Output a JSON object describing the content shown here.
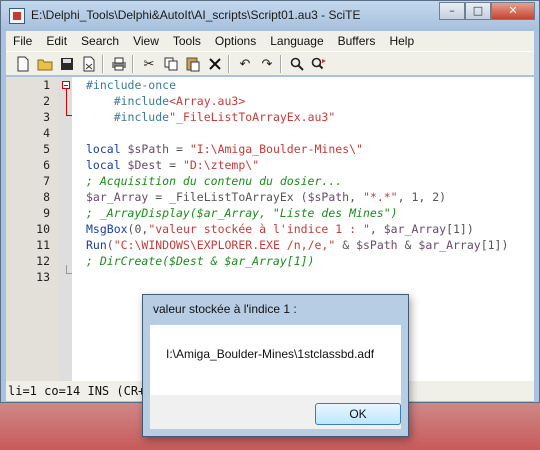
{
  "window": {
    "title": "E:\\Delphi_Tools\\Delphi&AutoIt\\AI_scripts\\Script01.au3 - SciTE",
    "buttons": {
      "minimize": "–",
      "maximize": "□",
      "close": "✕"
    }
  },
  "menu": [
    "File",
    "Edit",
    "Search",
    "View",
    "Tools",
    "Options",
    "Language",
    "Buffers",
    "Help"
  ],
  "toolbar_icons": [
    "new-file-icon",
    "open-folder-icon",
    "save-icon",
    "close-file-icon",
    "print-icon",
    "cut-icon",
    "copy-icon",
    "paste-icon",
    "delete-icon",
    "undo-icon",
    "redo-icon",
    "find-icon",
    "replace-icon"
  ],
  "editor": {
    "lines": [
      {
        "n": "1",
        "parts": [
          {
            "t": "#include-once",
            "c": "dir"
          }
        ]
      },
      {
        "n": "2",
        "parts": [
          {
            "t": "    #include",
            "c": "dir"
          },
          {
            "t": "<Array.au3>",
            "c": "str"
          }
        ]
      },
      {
        "n": "3",
        "parts": [
          {
            "t": "    #include",
            "c": "dir"
          },
          {
            "t": "\"_FileListToArrayEx.au3\"",
            "c": "str"
          }
        ]
      },
      {
        "n": "4",
        "parts": []
      },
      {
        "n": "5",
        "parts": [
          {
            "t": "local ",
            "c": "kw"
          },
          {
            "t": "$sPath",
            "c": "var"
          },
          {
            "t": " = ",
            "c": "op"
          },
          {
            "t": "\"I:\\Amiga_Boulder-Mines\\\"",
            "c": "str"
          }
        ]
      },
      {
        "n": "6",
        "parts": [
          {
            "t": "local ",
            "c": "kw"
          },
          {
            "t": "$Dest",
            "c": "var"
          },
          {
            "t": " = ",
            "c": "op"
          },
          {
            "t": "\"D:\\ztemp\\\"",
            "c": "str"
          }
        ]
      },
      {
        "n": "7",
        "parts": [
          {
            "t": "; Acquisition du contenu du dosier...",
            "c": "com"
          }
        ]
      },
      {
        "n": "8",
        "parts": [
          {
            "t": "$ar_Array",
            "c": "var"
          },
          {
            "t": " = _FileListToArrayEx (",
            "c": "op"
          },
          {
            "t": "$sPath",
            "c": "var"
          },
          {
            "t": ", ",
            "c": "op"
          },
          {
            "t": "\"*.*\"",
            "c": "str"
          },
          {
            "t": ", 1, 2)",
            "c": "op"
          }
        ]
      },
      {
        "n": "9",
        "parts": [
          {
            "t": "; _ArrayDisplay($ar_Array, \"Liste des Mines\")",
            "c": "com"
          }
        ]
      },
      {
        "n": "10",
        "parts": [
          {
            "t": "MsgBox",
            "c": "fn"
          },
          {
            "t": "(0,",
            "c": "op"
          },
          {
            "t": "\"valeur stockée à l'indice 1 : \"",
            "c": "str"
          },
          {
            "t": ", ",
            "c": "op"
          },
          {
            "t": "$ar_Array",
            "c": "var"
          },
          {
            "t": "[1])",
            "c": "op"
          }
        ]
      },
      {
        "n": "11",
        "parts": [
          {
            "t": "Run",
            "c": "fn"
          },
          {
            "t": "(",
            "c": "op"
          },
          {
            "t": "\"C:\\WINDOWS\\EXPLORER.EXE /n,/e,\"",
            "c": "str"
          },
          {
            "t": " & ",
            "c": "op"
          },
          {
            "t": "$sPath",
            "c": "var"
          },
          {
            "t": " & ",
            "c": "op"
          },
          {
            "t": "$ar_Array",
            "c": "var"
          },
          {
            "t": "[1])",
            "c": "op"
          }
        ]
      },
      {
        "n": "12",
        "parts": [
          {
            "t": "; DirCreate($Dest & $ar_Array[1])",
            "c": "com"
          }
        ]
      },
      {
        "n": "13",
        "parts": []
      }
    ]
  },
  "status": "li=1 co=14 INS (CR+LF)",
  "dialog": {
    "title": "valeur stockée à l'indice 1 :",
    "message": "I:\\Amiga_Boulder-Mines\\1stclassbd.adf",
    "ok_label": "OK"
  },
  "colors": {
    "directive": "#3a7a9a",
    "string": "#c23c3c",
    "keyword": "#1c3fa0",
    "comment": "#1d8a1d"
  }
}
